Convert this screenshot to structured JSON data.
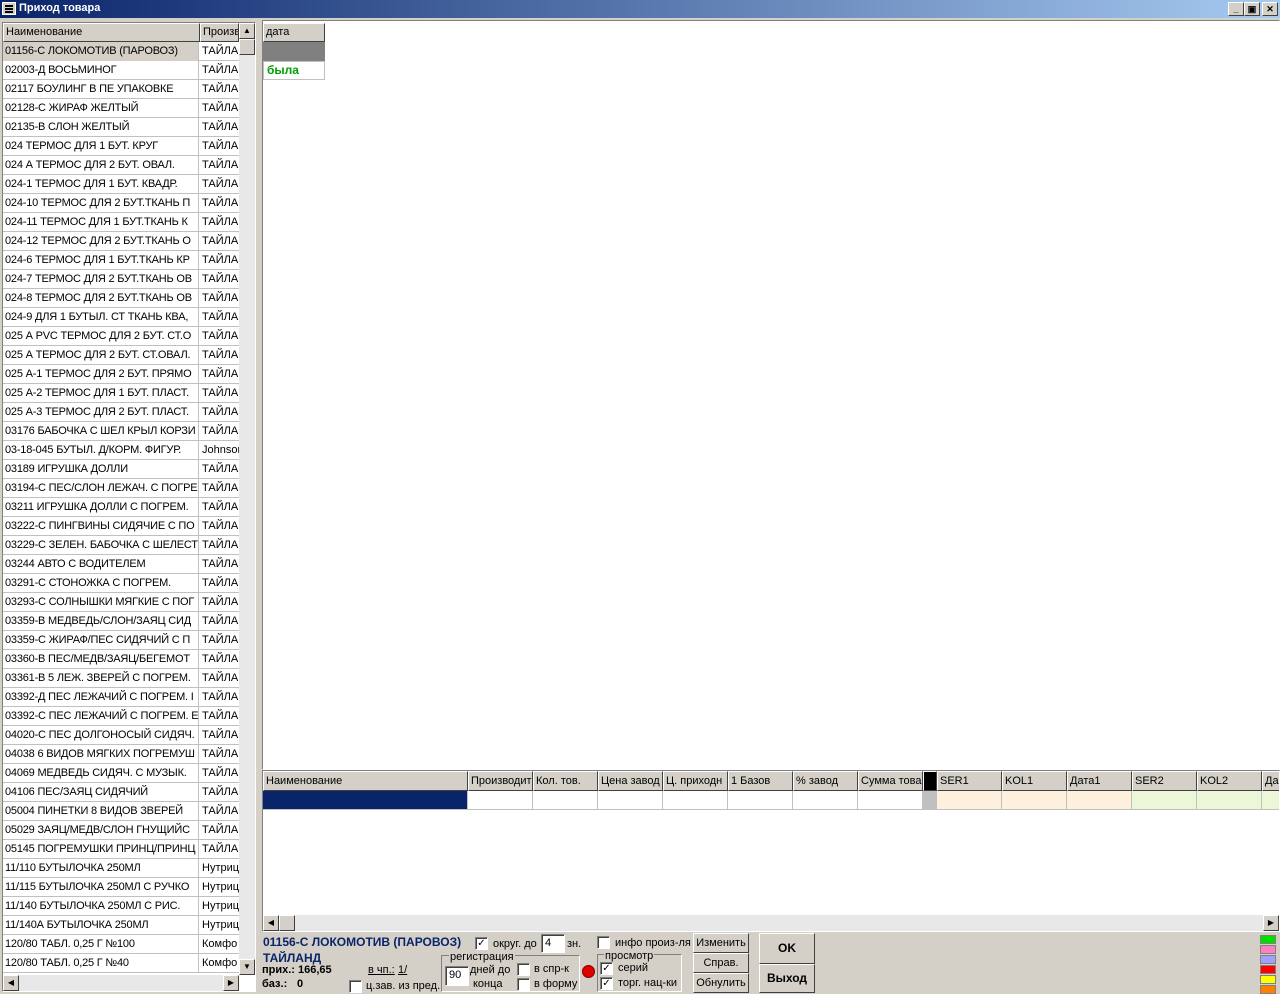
{
  "window": {
    "title": "Приход товара",
    "min_label": "_",
    "restore_label": "▣",
    "close_label": "✕"
  },
  "left_grid": {
    "headers": [
      "Наименование",
      "Произв"
    ],
    "rows": [
      {
        "name": "01156-С ЛОКОМОТИВ (ПАРОВОЗ)",
        "maker": "ТАЙЛА"
      },
      {
        "name": "02003-Д ВОСЬМИНОГ",
        "maker": "ТАЙЛА"
      },
      {
        "name": "02117 БОУЛИНГ В ПЕ УПАКОВКЕ",
        "maker": "ТАЙЛА"
      },
      {
        "name": "02128-С ЖИРАФ ЖЕЛТЫЙ",
        "maker": "ТАЙЛА"
      },
      {
        "name": "02135-В СЛОН ЖЕЛТЫЙ",
        "maker": "ТАЙЛА"
      },
      {
        "name": "024  ТЕРМОС ДЛЯ 1 БУТ. КРУГ",
        "maker": "ТАЙЛА"
      },
      {
        "name": "024 А ТЕРМОС ДЛЯ 2 БУТ. ОВАЛ.",
        "maker": "ТАЙЛА"
      },
      {
        "name": "024-1 ТЕРМОС ДЛЯ 1 БУТ. КВАДР.",
        "maker": "ТАЙЛА"
      },
      {
        "name": "024-10 ТЕРМОС ДЛЯ 2 БУТ.ТКАНЬ П",
        "maker": "ТАЙЛА"
      },
      {
        "name": "024-11 ТЕРМОС ДЛЯ 1 БУТ.ТКАНЬ К",
        "maker": "ТАЙЛА"
      },
      {
        "name": "024-12 ТЕРМОС ДЛЯ 2 БУТ.ТКАНЬ О",
        "maker": "ТАЙЛА"
      },
      {
        "name": "024-6 ТЕРМОС ДЛЯ 1 БУТ.ТКАНЬ КР",
        "maker": "ТАЙЛА"
      },
      {
        "name": "024-7 ТЕРМОС ДЛЯ 2 БУТ.ТКАНЬ ОВ",
        "maker": "ТАЙЛА"
      },
      {
        "name": "024-8 ТЕРМОС ДЛЯ 2 БУТ.ТКАНЬ ОВ",
        "maker": "ТАЙЛА"
      },
      {
        "name": "024-9 ДЛЯ 1 БУТЫЛ. СТ ТКАНЬ КВА,",
        "maker": "ТАЙЛА"
      },
      {
        "name": "025 А РVC ТЕРМОС ДЛЯ 2 БУТ. СТ.О",
        "maker": "ТАЙЛА"
      },
      {
        "name": "025 А ТЕРМОС ДЛЯ 2 БУТ. СТ.ОВАЛ.",
        "maker": "ТАЙЛА"
      },
      {
        "name": "025 А-1 ТЕРМОС ДЛЯ 2 БУТ. ПРЯМО",
        "maker": "ТАЙЛА"
      },
      {
        "name": "025 А-2 ТЕРМОС ДЛЯ 1 БУТ. ПЛАСТ.",
        "maker": "ТАЙЛА"
      },
      {
        "name": "025 А-3 ТЕРМОС ДЛЯ 2 БУТ. ПЛАСТ.",
        "maker": "ТАЙЛА"
      },
      {
        "name": "03176 БАБОЧКА С ШЕЛ КРЫЛ КОРЗИ",
        "maker": "ТАЙЛА"
      },
      {
        "name": "03-18-045 БУТЫЛ. Д/КОРМ. ФИГУР.",
        "maker": "Johnsor"
      },
      {
        "name": "03189 ИГРУШКА ДОЛЛИ",
        "maker": "ТАЙЛА"
      },
      {
        "name": "03194-С ПЕС/СЛОН ЛЕЖАЧ. С ПОГРЕ",
        "maker": "ТАЙЛА"
      },
      {
        "name": "03211 ИГРУШКА ДОЛЛИ С ПОГРЕМ.",
        "maker": "ТАЙЛА"
      },
      {
        "name": "03222-С ПИНГВИНЫ СИДЯЧИЕ С ПО",
        "maker": "ТАЙЛА"
      },
      {
        "name": "03229-С ЗЕЛЕН. БАБОЧКА С ШЕЛЕСТ",
        "maker": "ТАЙЛА"
      },
      {
        "name": "03244 АВТО С ВОДИТЕЛЕМ",
        "maker": "ТАЙЛА"
      },
      {
        "name": "03291-С СТОНОЖКА С ПОГРЕМ.",
        "maker": "ТАЙЛА"
      },
      {
        "name": "03293-С СОЛНЫШКИ МЯГКИЕ С ПОГ",
        "maker": "ТАЙЛА"
      },
      {
        "name": "03359-В МЕДВЕДЬ/СЛОН/ЗАЯЦ СИД",
        "maker": "ТАЙЛА"
      },
      {
        "name": "03359-С ЖИРАФ/ПЕС СИДЯЧИЙ С П",
        "maker": "ТАЙЛА"
      },
      {
        "name": "03360-В ПЕС/МЕДВ/ЗАЯЦ/БЕГЕМОТ",
        "maker": "ТАЙЛА"
      },
      {
        "name": "03361-В 5 ЛЕЖ. ЗВЕРЕЙ С ПОГРЕМ.",
        "maker": "ТАЙЛА"
      },
      {
        "name": "03392-Д ПЕС ЛЕЖАЧИЙ С ПОГРЕМ. I",
        "maker": "ТАЙЛА"
      },
      {
        "name": "03392-С ПЕС ЛЕЖАЧИЙ С ПОГРЕМ. Е",
        "maker": "ТАЙЛА"
      },
      {
        "name": "04020-С ПЕС ДОЛГОНОСЫЙ СИДЯЧ.",
        "maker": "ТАЙЛА"
      },
      {
        "name": "04038 6 ВИДОВ МЯГКИХ ПОГРЕМУШ",
        "maker": "ТАЙЛА"
      },
      {
        "name": "04069 МЕДВЕДЬ СИДЯЧ. С МУЗЫК.",
        "maker": "ТАЙЛА"
      },
      {
        "name": "04106 ПЕС/ЗАЯЦ СИДЯЧИЙ",
        "maker": "ТАЙЛА"
      },
      {
        "name": "05004 ПИНЕТКИ 8 ВИДОВ ЗВЕРЕЙ",
        "maker": "ТАЙЛА"
      },
      {
        "name": "05029 ЗАЯЦ/МЕДВ/СЛОН ГНУЩИЙС",
        "maker": "ТАЙЛА"
      },
      {
        "name": "05145 ПОГРЕМУШКИ ПРИНЦ/ПРИНЦ",
        "maker": "ТАЙЛА"
      },
      {
        "name": "11/110 БУТЫЛОЧКА 250МЛ",
        "maker": "Нутриц"
      },
      {
        "name": "11/115 БУТЫЛОЧКА 250МЛ С РУЧКО",
        "maker": "Нутриц"
      },
      {
        "name": "11/140 БУТЫЛОЧКА 250МЛ С РИС.",
        "maker": "Нутриц"
      },
      {
        "name": "11/140А БУТЫЛОЧКА 250МЛ",
        "maker": "Нутриц"
      },
      {
        "name": "120/80 ТАБЛ. 0,25 Г №100",
        "maker": "Комфо"
      },
      {
        "name": "120/80 ТАБЛ. 0,25 Г №40",
        "maker": "Комфо"
      }
    ]
  },
  "top_mini_grid": {
    "header": "дата",
    "value": "была"
  },
  "bottom_grid": {
    "headers": [
      "Наименование",
      "Производит",
      "Кол. тов.",
      "Цена завод",
      "Ц. приходн",
      "1 Базов",
      "% завод",
      "Сумма това",
      "",
      "SER1",
      "KOL1",
      "Дата1",
      "SER2",
      "KOL2",
      "Да"
    ]
  },
  "status": {
    "product_name": "01156-С ЛОКОМОТИВ (ПАРОВОЗ)",
    "country": "ТАЙЛАНД",
    "prih_label": "прих.:",
    "prih_value": "166,65",
    "baz_label": "баз.:",
    "baz_value": "0",
    "vchp_label": "в чп.:",
    "vchp_value": "1/",
    "czav_label": "ц.зав. из пред.",
    "okrug_label": "округ. до",
    "okrug_value": "4",
    "zn_label": "зн.",
    "reg_legend": "регистрация",
    "reg_days_value": "90",
    "reg_days_label": "дней до",
    "reg_end_label": "конца",
    "v_sprk_label": "в спр-к",
    "v_formu_label": "в форму",
    "info_label": "инфо произ-ля",
    "prosmotr_legend": "просмотр",
    "seriy_label": "серий",
    "torg_label": "торг. нац-ки",
    "izmenit_label": "Изменить",
    "sprav_label": "Справ.",
    "obnulit_label": "Обнулить",
    "ok_label": "OK",
    "exit_label": "Выход"
  },
  "colors": {
    "title_start": "#0a246a",
    "title_end": "#a6caf0",
    "selection": "#0a246a",
    "green_text": "#00a000",
    "status_blue": "#0a246a",
    "peach": "#fdf0dc",
    "lightgreen": "#ecf7d8",
    "swatches": [
      "#00e000",
      "#ff80c0",
      "#a0a0ff",
      "#ff0000",
      "#ffff00",
      "#ff8000"
    ]
  }
}
